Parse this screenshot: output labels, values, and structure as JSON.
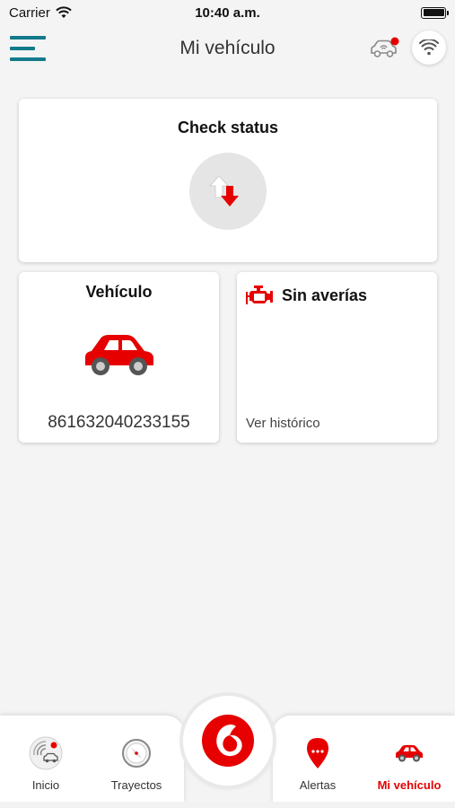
{
  "status_bar": {
    "carrier": "Carrier",
    "time": "10:40 a.m."
  },
  "header": {
    "title": "Mi vehículo",
    "menu_icon": "hamburger-icon",
    "car_icon": "car-alert-icon",
    "wifi_icon": "wifi-icon"
  },
  "check_status": {
    "title": "Check status",
    "icon": "sync-arrows-icon"
  },
  "vehicle": {
    "title": "Vehículo",
    "icon": "red-car-icon",
    "id": "861632040233155"
  },
  "faults": {
    "title": "Sin averías",
    "icon": "engine-icon",
    "link": "Ver histórico"
  },
  "nav": {
    "items": [
      {
        "label": "Inicio",
        "icon": "radar-icon"
      },
      {
        "label": "Trayectos",
        "icon": "compass-icon"
      },
      {
        "label": "Alertas",
        "icon": "alert-pin-icon"
      },
      {
        "label": "Mi vehículo",
        "icon": "car-icon"
      }
    ],
    "center_icon": "vodafone-logo-icon"
  },
  "colors": {
    "brand_red": "#e60000",
    "teal": "#137a8c",
    "background": "#f4f4f4"
  }
}
